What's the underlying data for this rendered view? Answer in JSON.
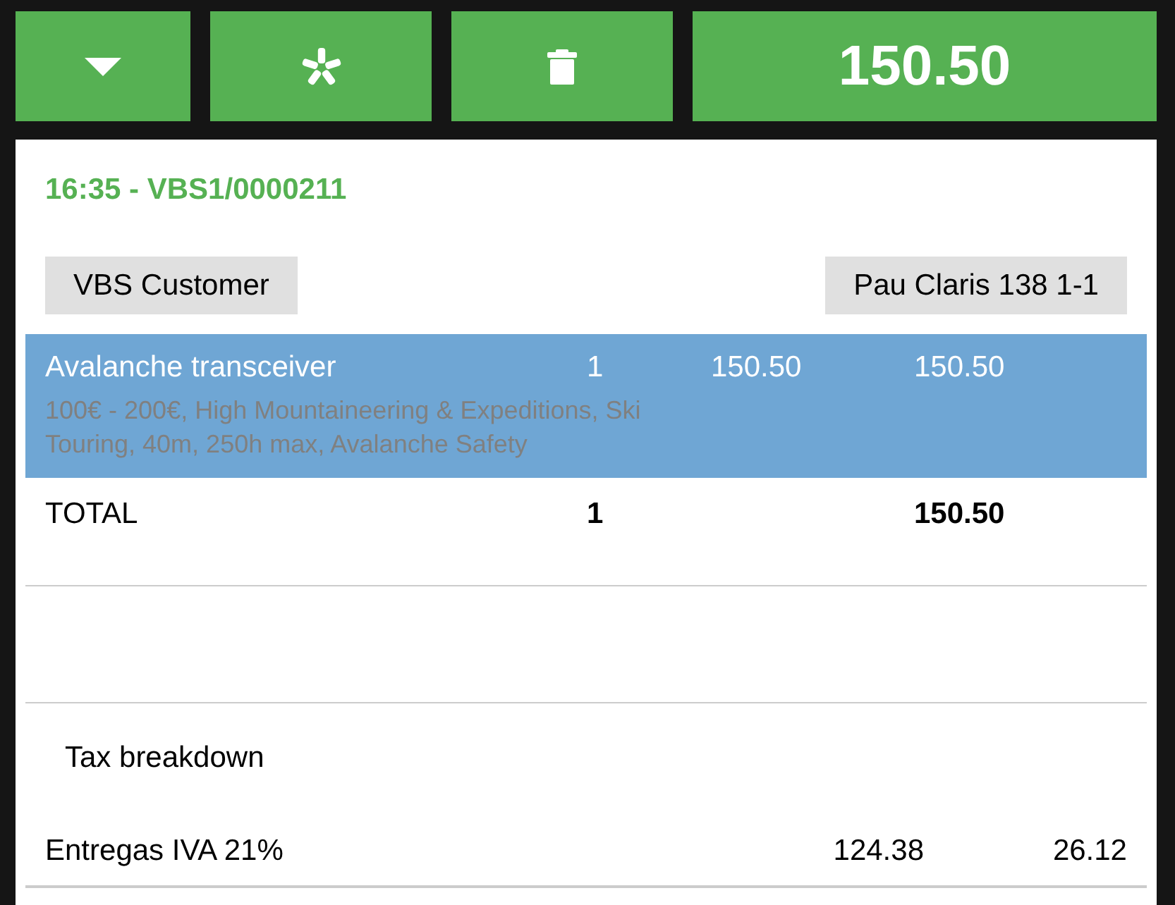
{
  "toolbar": {
    "buttons": [
      {
        "kind": "dropdown"
      },
      {
        "kind": "asterisk"
      },
      {
        "kind": "delete"
      }
    ],
    "total": "150.50"
  },
  "order": {
    "title": "16:35 - VBS1/0000211",
    "customer": "VBS Customer",
    "address": "Pau Claris 138 1-1"
  },
  "lines": [
    {
      "name": "Avalanche transceiver",
      "quantity": "1",
      "price": "150.50",
      "total": "150.50",
      "description": "100€ - 200€, High Mountaineering & Expeditions, Ski Touring, 40m, 250h max, Avalanche Safety",
      "selected": true
    }
  ],
  "totals": {
    "label": "TOTAL",
    "quantity": "1",
    "amount": "150.50"
  },
  "tax_breakdown": {
    "title": "Tax breakdown",
    "rows": [
      {
        "name": "Entregas IVA 21%",
        "base": "124.38",
        "amount": "26.12"
      }
    ]
  }
}
